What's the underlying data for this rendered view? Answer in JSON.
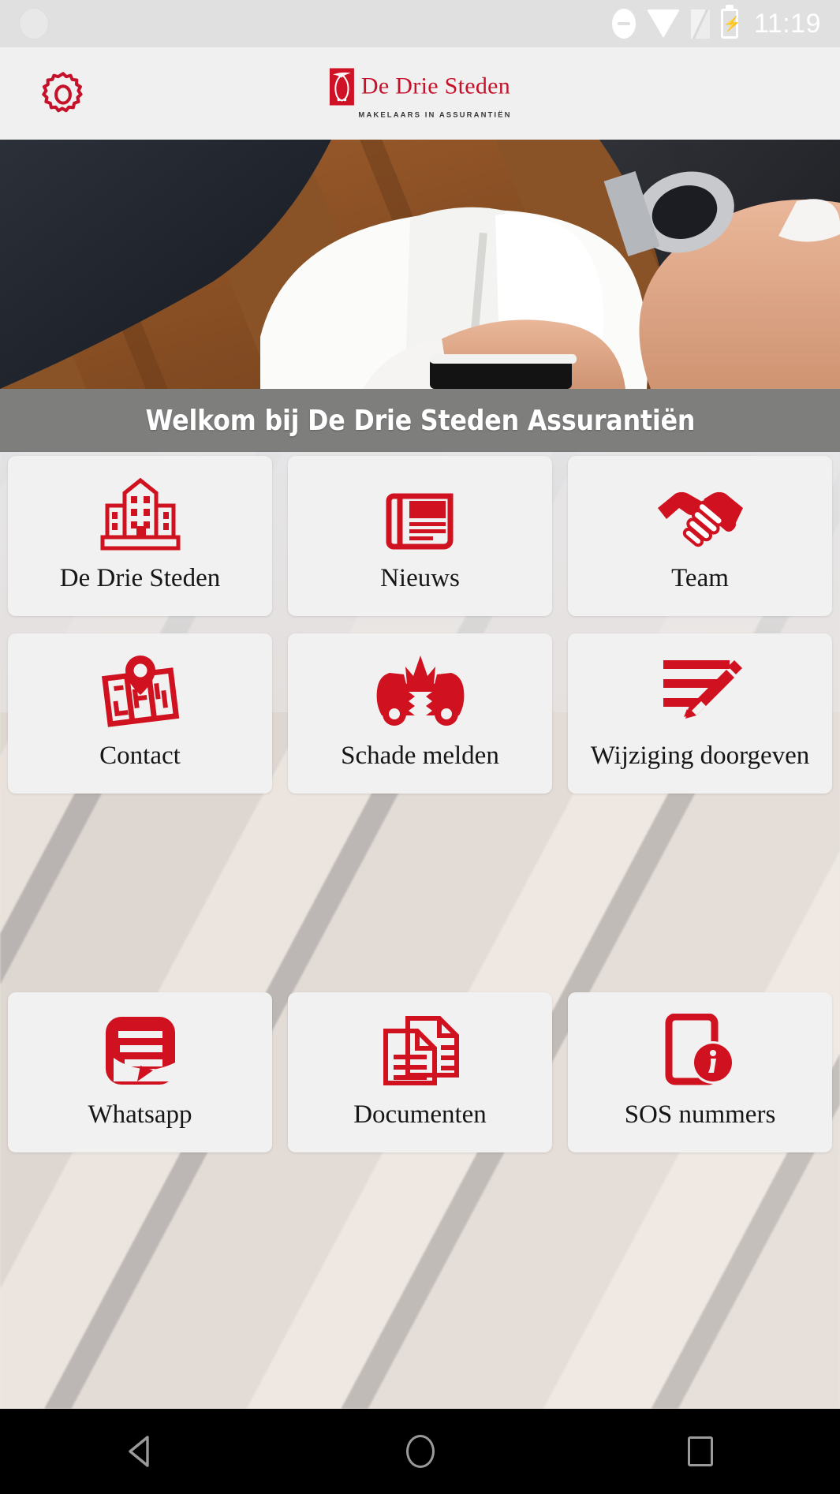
{
  "status_bar": {
    "time": "11:19",
    "icons": [
      "dnd-icon",
      "wifi-icon",
      "signal-icon",
      "battery-charging-icon"
    ]
  },
  "header": {
    "settings_icon": "gear-icon",
    "brand_name": "De Drie Steden",
    "brand_tagline": "MAKELAARS IN ASSURANTIËN",
    "brand_mark": "owl-logo-icon",
    "brand_color": "#c5122a"
  },
  "hero": {
    "alt": "businessmen-reviewing-documents-photo"
  },
  "banner": {
    "text": "Welkom bij De Drie Steden Assurantiën"
  },
  "grid": {
    "tiles": [
      {
        "label": "De Drie Steden",
        "icon": "building-icon"
      },
      {
        "label": "Nieuws",
        "icon": "newspaper-icon"
      },
      {
        "label": "Team",
        "icon": "handshake-icon"
      },
      {
        "label": "Contact",
        "icon": "map-pin-icon"
      },
      {
        "label": "Schade melden",
        "icon": "car-crash-icon"
      },
      {
        "label": "Wijziging doorgeven",
        "icon": "pencil-edit-icon"
      },
      {
        "label": "Whatsapp",
        "icon": "chat-bubble-icon"
      },
      {
        "label": "Documenten",
        "icon": "documents-icon"
      },
      {
        "label": "SOS nummers",
        "icon": "phone-info-icon"
      }
    ],
    "accent_color": "#d0111f",
    "tile_background": "#f2f1f1"
  },
  "navigation_bar": {
    "back": "back-triangle-icon",
    "home": "home-circle-icon",
    "recents": "recents-square-icon"
  }
}
